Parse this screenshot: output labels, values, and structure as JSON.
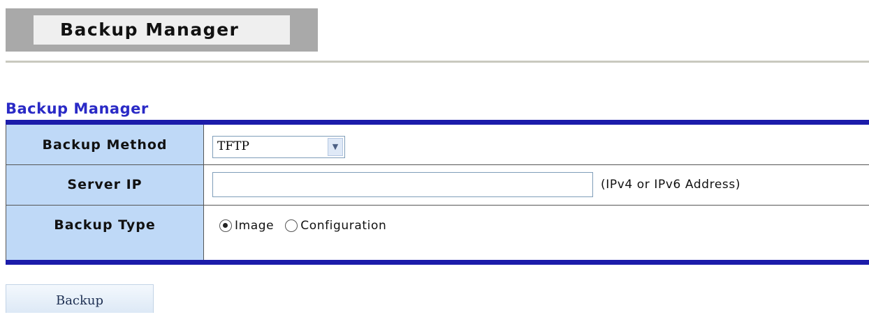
{
  "header": {
    "title": "Backup Manager"
  },
  "section": {
    "title": "Backup Manager"
  },
  "form": {
    "backup_method": {
      "label": "Backup Method",
      "selected": "TFTP"
    },
    "server_ip": {
      "label": "Server IP",
      "value": "",
      "hint": "(IPv4 or IPv6 Address)"
    },
    "backup_type": {
      "label": "Backup Type",
      "options": [
        {
          "label": "Image",
          "checked": true
        },
        {
          "label": "Configuration",
          "checked": false
        }
      ]
    }
  },
  "actions": {
    "backup_label": "Backup"
  },
  "colors": {
    "section_title": "#2a2ac6",
    "table_border": "#1c1caa",
    "label_cell_bg": "#bfd9f7",
    "header_block_bg": "#a9a9a9"
  },
  "icons": {
    "select_arrow": "chevron-down-icon",
    "radio_checked": "radio-checked-icon",
    "radio_unchecked": "radio-unchecked-icon"
  }
}
